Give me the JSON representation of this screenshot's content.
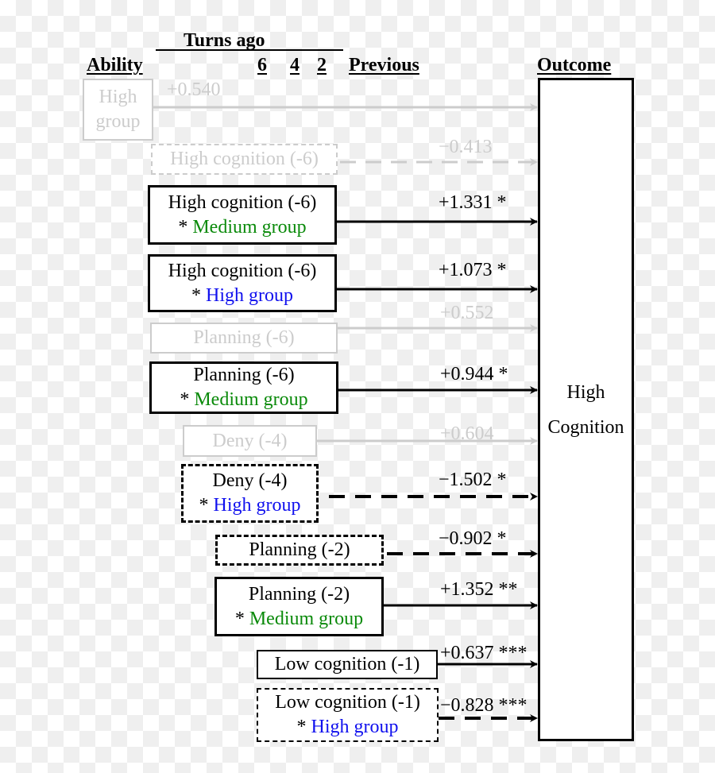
{
  "header": {
    "turns_ago": "Turns ago",
    "ability": "Ability",
    "col_6": "6",
    "col_4": "4",
    "col_2": "2",
    "previous": "Previous",
    "outcome": "Outcome"
  },
  "outcome_box": {
    "line1": "High",
    "line2": "Cognition"
  },
  "colors": {
    "medium_group": "#0a8a0a",
    "high_group": "#1010ee",
    "faded": "#cccccc",
    "significant": "#000000"
  },
  "predictors": [
    {
      "id": "high-group",
      "line1": "High",
      "line2": "group",
      "coef": "+0.540",
      "sig": "",
      "effect": "positive",
      "significant": false
    },
    {
      "id": "high-cognition-6",
      "line1": "High cognition (-6)",
      "line2": "",
      "coef": "−0.413",
      "sig": "",
      "effect": "negative",
      "significant": false
    },
    {
      "id": "high-cognition-6-medium",
      "line1": "High cognition (-6)",
      "line2_prefix": "* ",
      "line2": "Medium group",
      "group": "medium",
      "coef": "+1.331",
      "sig": "*",
      "effect": "positive",
      "significant": true
    },
    {
      "id": "high-cognition-6-high",
      "line1": "High cognition (-6)",
      "line2_prefix": "* ",
      "line2": "High group",
      "group": "high",
      "coef": "+1.073",
      "sig": "*",
      "effect": "positive",
      "significant": true
    },
    {
      "id": "planning-6",
      "line1": "Planning (-6)",
      "line2": "",
      "coef": "+0.552",
      "sig": "",
      "effect": "positive",
      "significant": false
    },
    {
      "id": "planning-6-medium",
      "line1": "Planning (-6)",
      "line2_prefix": "* ",
      "line2": "Medium group",
      "group": "medium",
      "coef": "+0.944",
      "sig": "*",
      "effect": "positive",
      "significant": true
    },
    {
      "id": "deny-4",
      "line1": "Deny (-4)",
      "line2": "",
      "coef": "+0.604",
      "sig": "",
      "effect": "positive",
      "significant": false
    },
    {
      "id": "deny-4-high",
      "line1": "Deny (-4)",
      "line2_prefix": "* ",
      "line2": "High group",
      "group": "high",
      "coef": "−1.502",
      "sig": "*",
      "effect": "negative",
      "significant": true
    },
    {
      "id": "planning-2",
      "line1": "Planning (-2)",
      "line2": "",
      "coef": "−0.902",
      "sig": "*",
      "effect": "negative",
      "significant": true
    },
    {
      "id": "planning-2-medium",
      "line1": "Planning (-2)",
      "line2_prefix": "* ",
      "line2": "Medium group",
      "group": "medium",
      "coef": "+1.352",
      "sig": "**",
      "effect": "positive",
      "significant": true
    },
    {
      "id": "low-cognition-1",
      "line1": "Low cognition (-1)",
      "line2": "",
      "coef": "+0.637",
      "sig": "***",
      "effect": "positive",
      "significant": true
    },
    {
      "id": "low-cognition-1-high",
      "line1": "Low cognition (-1)",
      "line2_prefix": "* ",
      "line2": "High group",
      "group": "high",
      "coef": "−0.828",
      "sig": "***",
      "effect": "negative",
      "significant": true
    }
  ]
}
